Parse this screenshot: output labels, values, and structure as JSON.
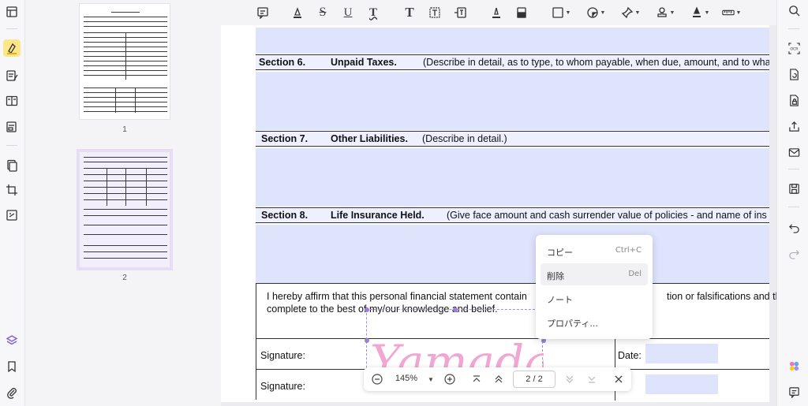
{
  "thumbnails": [
    {
      "page_label": "1"
    },
    {
      "page_label": "2"
    }
  ],
  "document": {
    "sections": [
      {
        "number": "Section 6.",
        "title": "Unpaid Taxes.",
        "description": "(Describe in detail, as to type, to whom payable, when due, amount, and to wha"
      },
      {
        "number": "Section 7.",
        "title": "Other Liabilities.",
        "description": "(Describe in detail.)"
      },
      {
        "number": "Section 8.",
        "title": "Life Insurance Held.",
        "description": "(Give face amount and cash surrender value of policies - and name of ins"
      }
    ],
    "affirmation_line1": "I hereby affirm that this personal financial statement contain",
    "affirmation_line1_end": "tion or falsifications and thi",
    "affirmation_line2": "complete to the best of my/our knowledge and belief.",
    "signature_label": "Signature:",
    "date_label": "Date:",
    "date_label_partial": "e:",
    "signature_text": "Yamada"
  },
  "context_menu": {
    "items": [
      {
        "label": "コピー",
        "shortcut": "Ctrl+C"
      },
      {
        "label": "削除",
        "shortcut": "Del"
      },
      {
        "label": "ノート",
        "shortcut": ""
      },
      {
        "label": "プロパティ...",
        "shortcut": ""
      }
    ]
  },
  "navbar": {
    "zoom": "145%",
    "page_indicator": "2 / 2"
  },
  "colors": {
    "form_field": "#dfe4fd",
    "signature": "#f2a7d2",
    "accent": "#9b7fe0",
    "highlight_active": "#fde68a"
  }
}
